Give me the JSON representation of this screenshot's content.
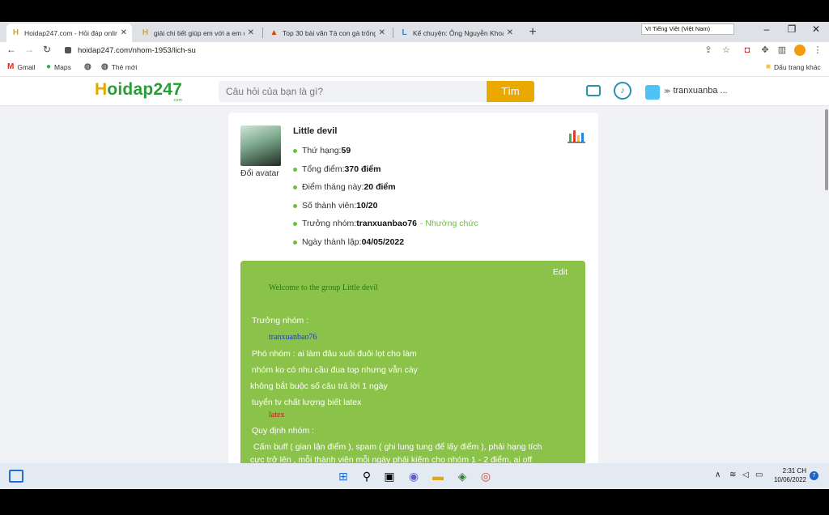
{
  "tabs": [
    {
      "title": "Hoidap247.com - Hỏi đáp online",
      "icon": "H"
    },
    {
      "title": "giải chi tiết giúp em với a em cần",
      "icon": "H"
    },
    {
      "title": "Top 30 bài văn Tả con gà trống h",
      "icon": "▲"
    },
    {
      "title": "Kể chuyện: Ông Nguyễn Khoa Đă",
      "icon": "L"
    }
  ],
  "ime": "VI  Tiếng Việt (Việt Nam)",
  "url": "hoidap247.com/nhom-1953/lich-su",
  "bookmarks": {
    "gmail": "Gmail",
    "maps": "Maps",
    "new": "Thẻ mới",
    "other": "Dấu trang khác"
  },
  "header": {
    "logo_h": "H",
    "logo_rest": "oidap247",
    "logo_com": ".com",
    "search_placeholder": "Câu hỏi của bạn là gì?",
    "search_button": "Tìm",
    "username": "tranxuanba ..."
  },
  "group": {
    "avatar_label": "Đổi avatar",
    "name": "Little devil",
    "stats": [
      {
        "label": "Thứ hạng: ",
        "value": "59"
      },
      {
        "label": "Tổng điểm: ",
        "value": "370 điểm"
      },
      {
        "label": "Điểm tháng này: ",
        "value": "20 điểm"
      },
      {
        "label": "Số thành viên: ",
        "value": "10/20"
      },
      {
        "label": "Trưởng nhóm: ",
        "value": "tranxuanbao76",
        "extra": " - Nhường chức"
      },
      {
        "label": "Ngày thành lập: ",
        "value": "04/05/2022"
      }
    ]
  },
  "description": {
    "edit": "Edit",
    "welcome": "Welcome to the group Little devil",
    "leader_title": "Trưởng nhóm :",
    "leader_name": "tranxuanbao76",
    "deputy": "Phó nhóm : ai làm đâu xuôi đuôi lọt cho làm",
    "line1": "nhóm ko có nhu cầu đua top nhưng vẫn cày",
    "line2": "không bắt buộc số câu trả lời 1 ngày",
    "line3": "tuyển tv chất lượng biết latex",
    "latex": "latex",
    "rules_title": "Quy định nhóm :",
    "rule1": "Cấm buff ( gian lận điểm ), spam ( ghi lung tung để lấy điểm ), phải hạng tích",
    "rule2": "cực trở lên , mỗi thành viên mỗi ngày phải kiếm cho nhóm 1 - 2 điểm, ai off"
  },
  "taskbar": {
    "time": "2:31 CH",
    "date": "10/06/2022",
    "notifications": "7"
  },
  "colors": {
    "brand_green": "#8bc34a",
    "button": "#e9a900",
    "accent": "#6cbf43"
  }
}
